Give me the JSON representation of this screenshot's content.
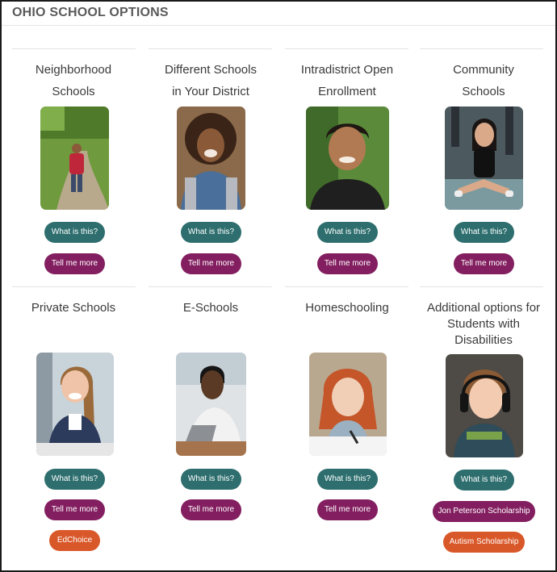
{
  "page": {
    "title": "OHIO SCHOOL OPTIONS"
  },
  "colors": {
    "teal": "#2e6e6e",
    "plum": "#831f60",
    "orange": "#d9582a"
  },
  "cards": [
    {
      "title_line1": "Neighborhood",
      "title_line2": "Schools",
      "photo": "child-walking-on-path-photo",
      "what": "What is this?",
      "more": "Tell me more"
    },
    {
      "title_line1": "Different Schools",
      "title_line2": "in Your District",
      "photo": "smiling-girl-photo",
      "what": "What is this?",
      "more": "Tell me more"
    },
    {
      "title_line1": "Intradistrict Open",
      "title_line2": "Enrollment",
      "photo": "smiling-boy-photo",
      "what": "What is this?",
      "more": "Tell me more"
    },
    {
      "title_line1": "Community",
      "title_line2": "Schools",
      "photo": "girl-sitting-on-floor-photo",
      "what": "What is this?",
      "more": "Tell me more"
    },
    {
      "title_line1": "Private Schools",
      "photo": "laughing-girl-in-class-photo",
      "what": "What is this?",
      "more": "Tell me more",
      "extra": "EdChoice"
    },
    {
      "title_line1": "E-Schools",
      "photo": "student-at-laptop-photo",
      "what": "What is this?",
      "more": "Tell me more"
    },
    {
      "title_line1": "Homeschooling",
      "photo": "girl-writing-photo",
      "what": "What is this?",
      "more": "Tell me more"
    },
    {
      "title_line1": "Additional options for",
      "title_line2": "Students with",
      "title_line3": "Disabilities",
      "photo": "boy-with-headphones-photo",
      "what": "What is this?",
      "more": "Jon Peterson Scholarship",
      "extra": "Autism Scholarship"
    }
  ]
}
